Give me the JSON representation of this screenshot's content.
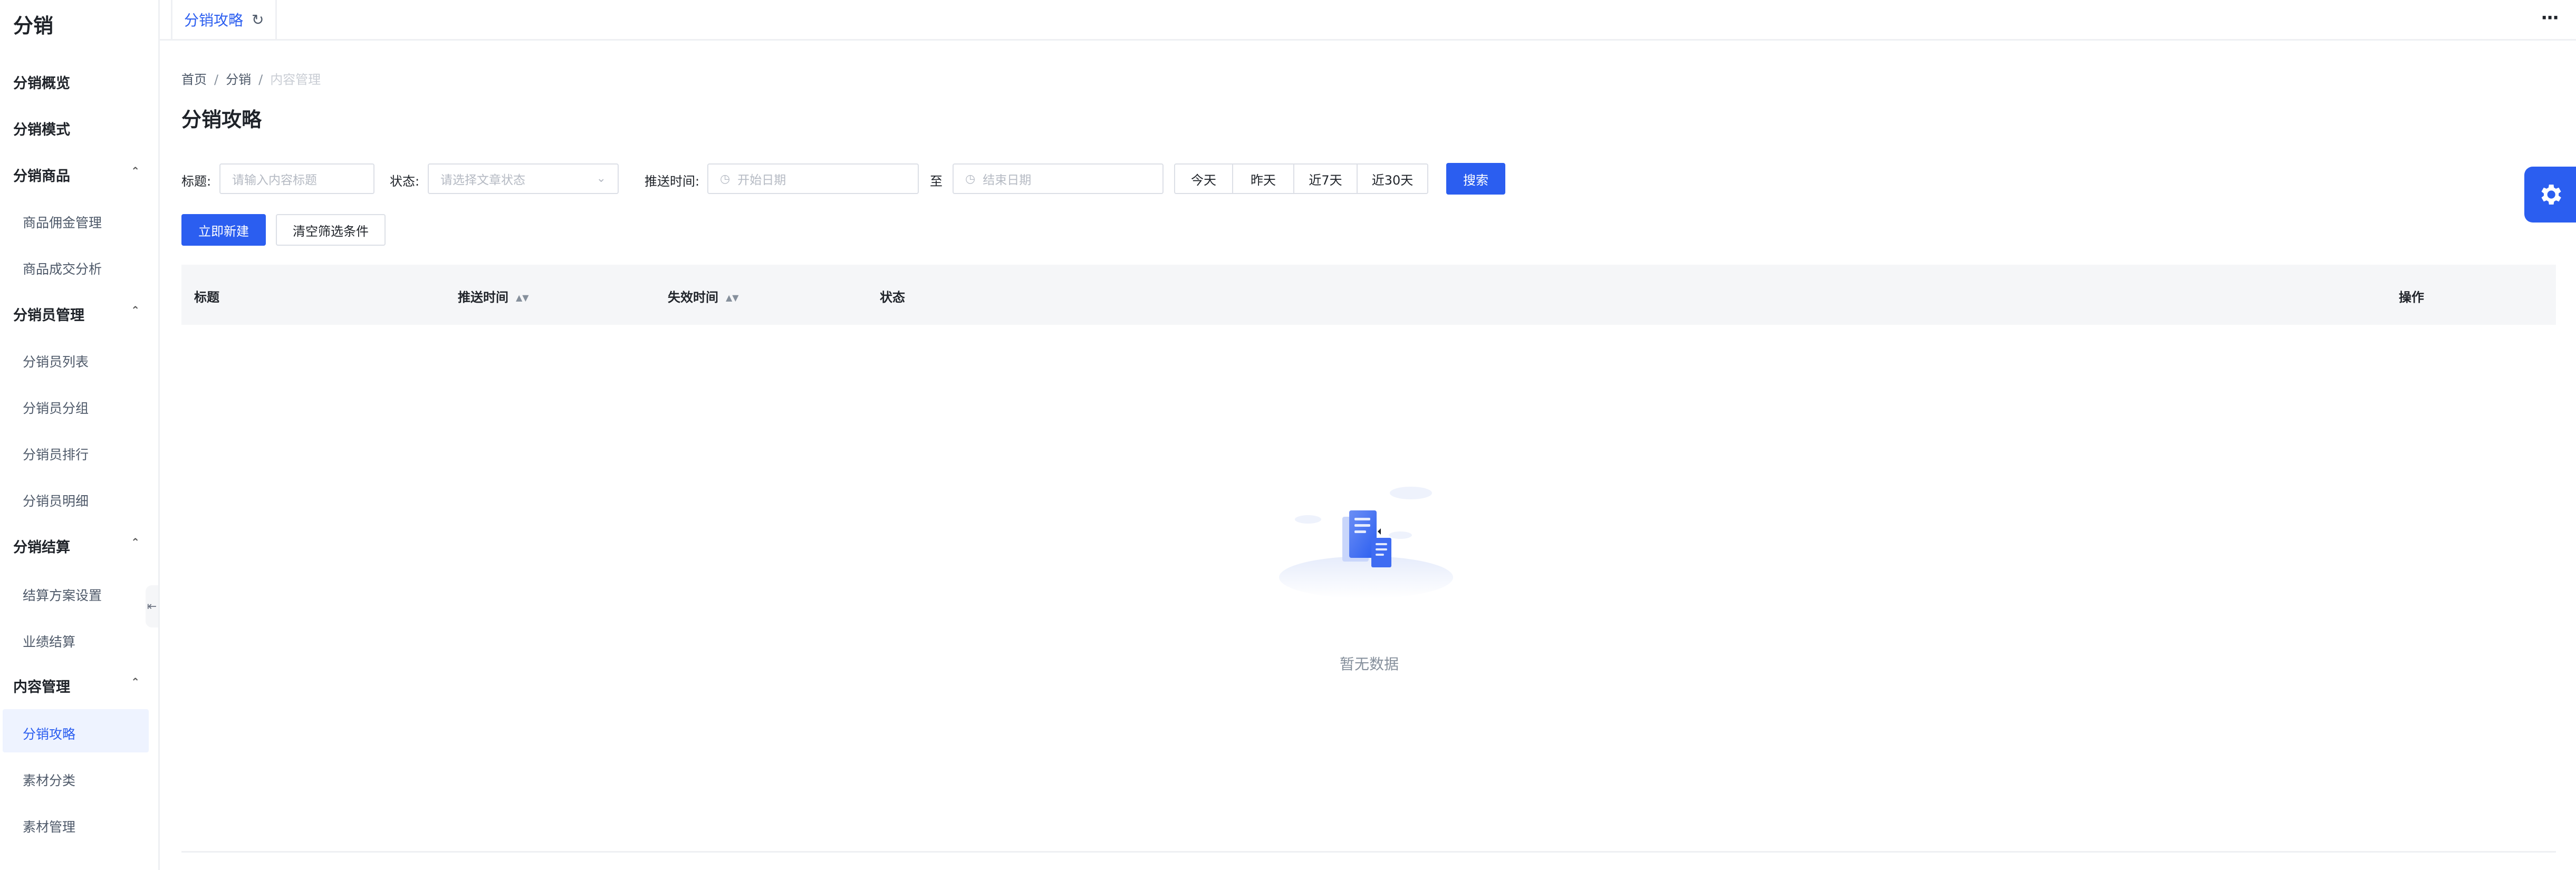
{
  "sidebar": {
    "title": "分销",
    "items": [
      {
        "label": "分销概览"
      },
      {
        "label": "分销模式"
      }
    ],
    "groups": [
      {
        "label": "分销商品",
        "children": [
          "商品佣金管理",
          "商品成交分析"
        ]
      },
      {
        "label": "分销员管理",
        "children": [
          "分销员列表",
          "分销员分组",
          "分销员排行",
          "分销员明细"
        ]
      },
      {
        "label": "分销结算",
        "children": [
          "结算方案设置",
          "业绩结算"
        ]
      },
      {
        "label": "内容管理",
        "children": [
          "分销攻略",
          "素材分类",
          "素材管理"
        ]
      }
    ],
    "active_item": "分销攻略",
    "collapse_icon": "sidebar-collapse-icon"
  },
  "topbar": {
    "active_tab": "分销攻略",
    "refresh_icon": "refresh-icon",
    "more_icon": "more-icon"
  },
  "breadcrumb": [
    "首页",
    "分销",
    "内容管理"
  ],
  "page_title": "分销攻略",
  "filters": {
    "title_label": "标题:",
    "title_placeholder": "请输入内容标题",
    "status_label": "状态:",
    "status_placeholder": "请选择文章状态",
    "push_time_label": "推送时间:",
    "start_placeholder": "开始日期",
    "to_label": "至",
    "end_placeholder": "结束日期",
    "quick_ranges": [
      "今天",
      "昨天",
      "近7天",
      "近30天"
    ],
    "search_button": "搜索"
  },
  "actions": {
    "create_button": "立即新建",
    "clear_button": "清空筛选条件"
  },
  "table": {
    "columns": [
      "标题",
      "推送时间",
      "失效时间",
      "状态",
      "操作"
    ],
    "empty_text": "暂无数据"
  },
  "colors": {
    "primary": "#2b5ef0",
    "header_bg": "#f5f6f8",
    "active_nav_bg": "#eef3ff"
  }
}
